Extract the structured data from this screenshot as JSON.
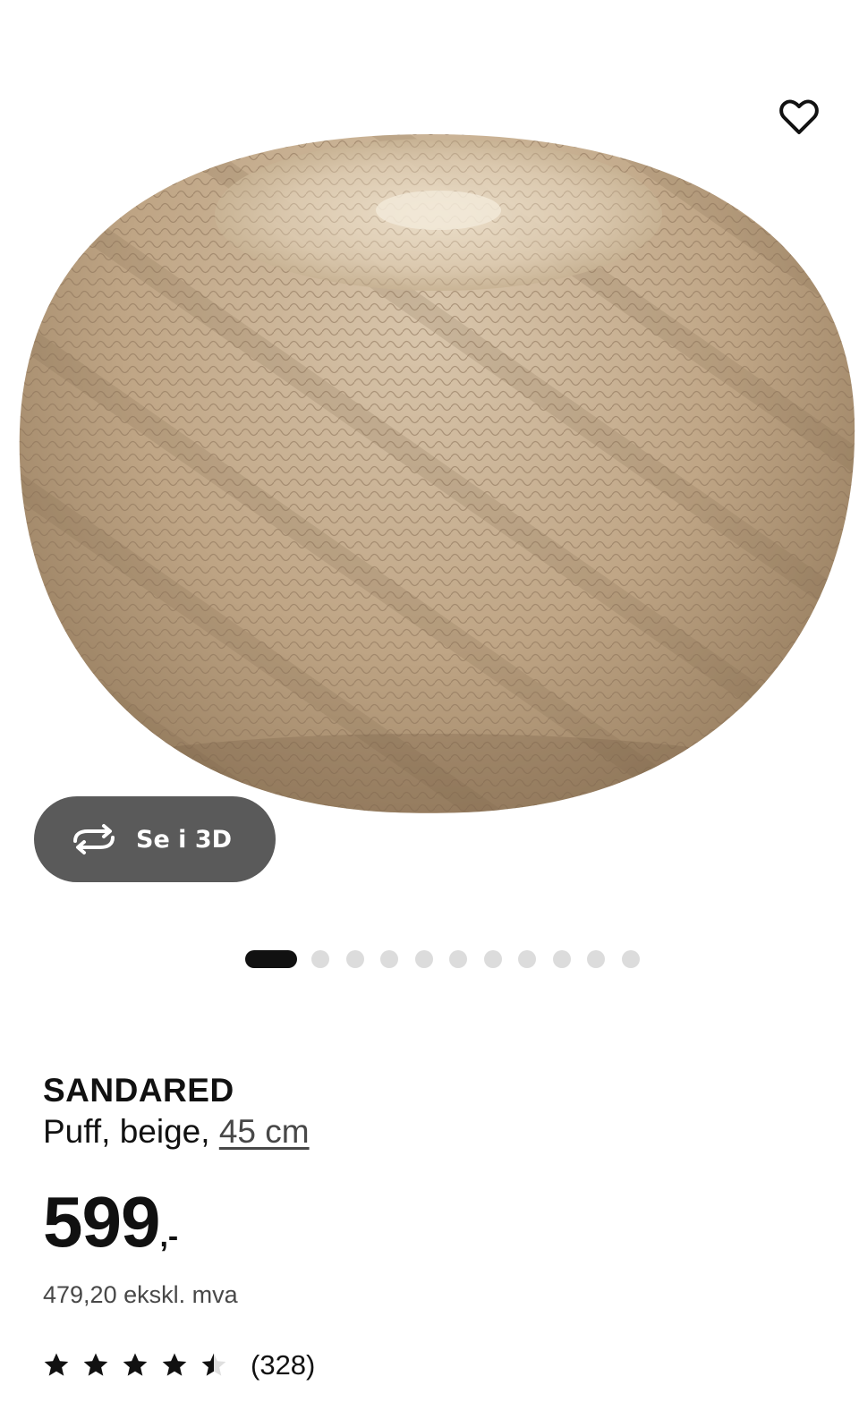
{
  "product_image": {
    "alt": "SANDARED Puff, beige"
  },
  "favourite": {
    "icon": "heart-outline-icon"
  },
  "view_3d": {
    "label": "Se i 3D",
    "icon": "rotate-3d-icon"
  },
  "carousel": {
    "total": 11,
    "active_index": 0
  },
  "product": {
    "name": "SANDARED",
    "description_prefix": "Puff, beige,",
    "size_link": "45 cm"
  },
  "price": {
    "integer": "599",
    "decimal": ",-",
    "excl_vat": "479,20 ekskl. mva"
  },
  "rating": {
    "value": 4.5,
    "max": 5,
    "review_count": "(328)"
  },
  "colors": {
    "text": "#111111",
    "secondary_text": "#484848",
    "button_bg": "#5a5a5a",
    "dot_inactive": "#dcdcdc"
  }
}
